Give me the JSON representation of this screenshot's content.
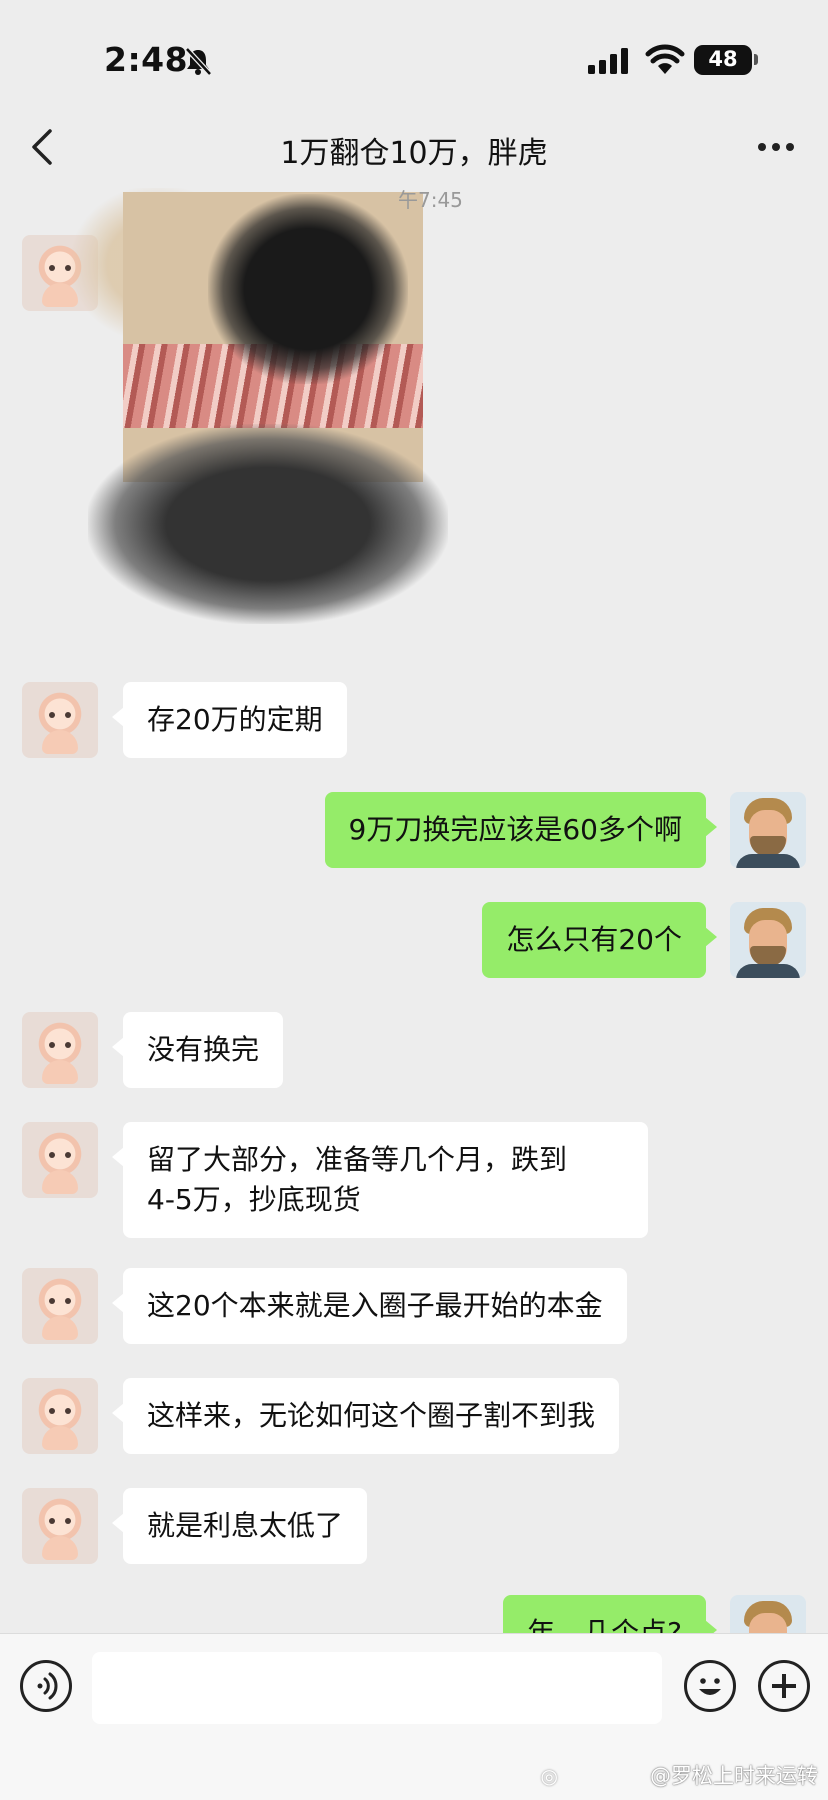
{
  "status_bar": {
    "time": "2:48",
    "battery": "48"
  },
  "header": {
    "title": "1万翻仓10万，胖虎"
  },
  "photo": {
    "timestamp": "午7:45"
  },
  "messages": [
    {
      "side": "left",
      "text": "存20万的定期"
    },
    {
      "side": "right",
      "text": "9万刀换完应该是60多个啊"
    },
    {
      "side": "right",
      "text": "怎么只有20个"
    },
    {
      "side": "left",
      "text": "没有换完"
    },
    {
      "side": "left",
      "text": "留了大部分，准备等几个月，跌到\n4-5万，抄底现货"
    },
    {
      "side": "left",
      "text": "这20个本来就是入圈子最开始的本金"
    },
    {
      "side": "left",
      "text": "这样来，无论如何这个圈子割不到我"
    },
    {
      "side": "left",
      "text": "就是利息太低了"
    },
    {
      "side": "right",
      "text": "年，几个点?"
    }
  ],
  "input": {
    "value": "",
    "placeholder": ""
  },
  "watermark": {
    "text": "@罗松上时来运转"
  },
  "colors": {
    "background": "#ededed",
    "bubble_self": "#95ec69",
    "bubble_other": "#ffffff"
  },
  "icons": [
    "bell-slash-icon",
    "signal-icon",
    "wifi-icon",
    "battery-icon",
    "back-icon",
    "more-icon",
    "voice-icon",
    "emoji-icon",
    "plus-icon",
    "weibo-icon"
  ]
}
